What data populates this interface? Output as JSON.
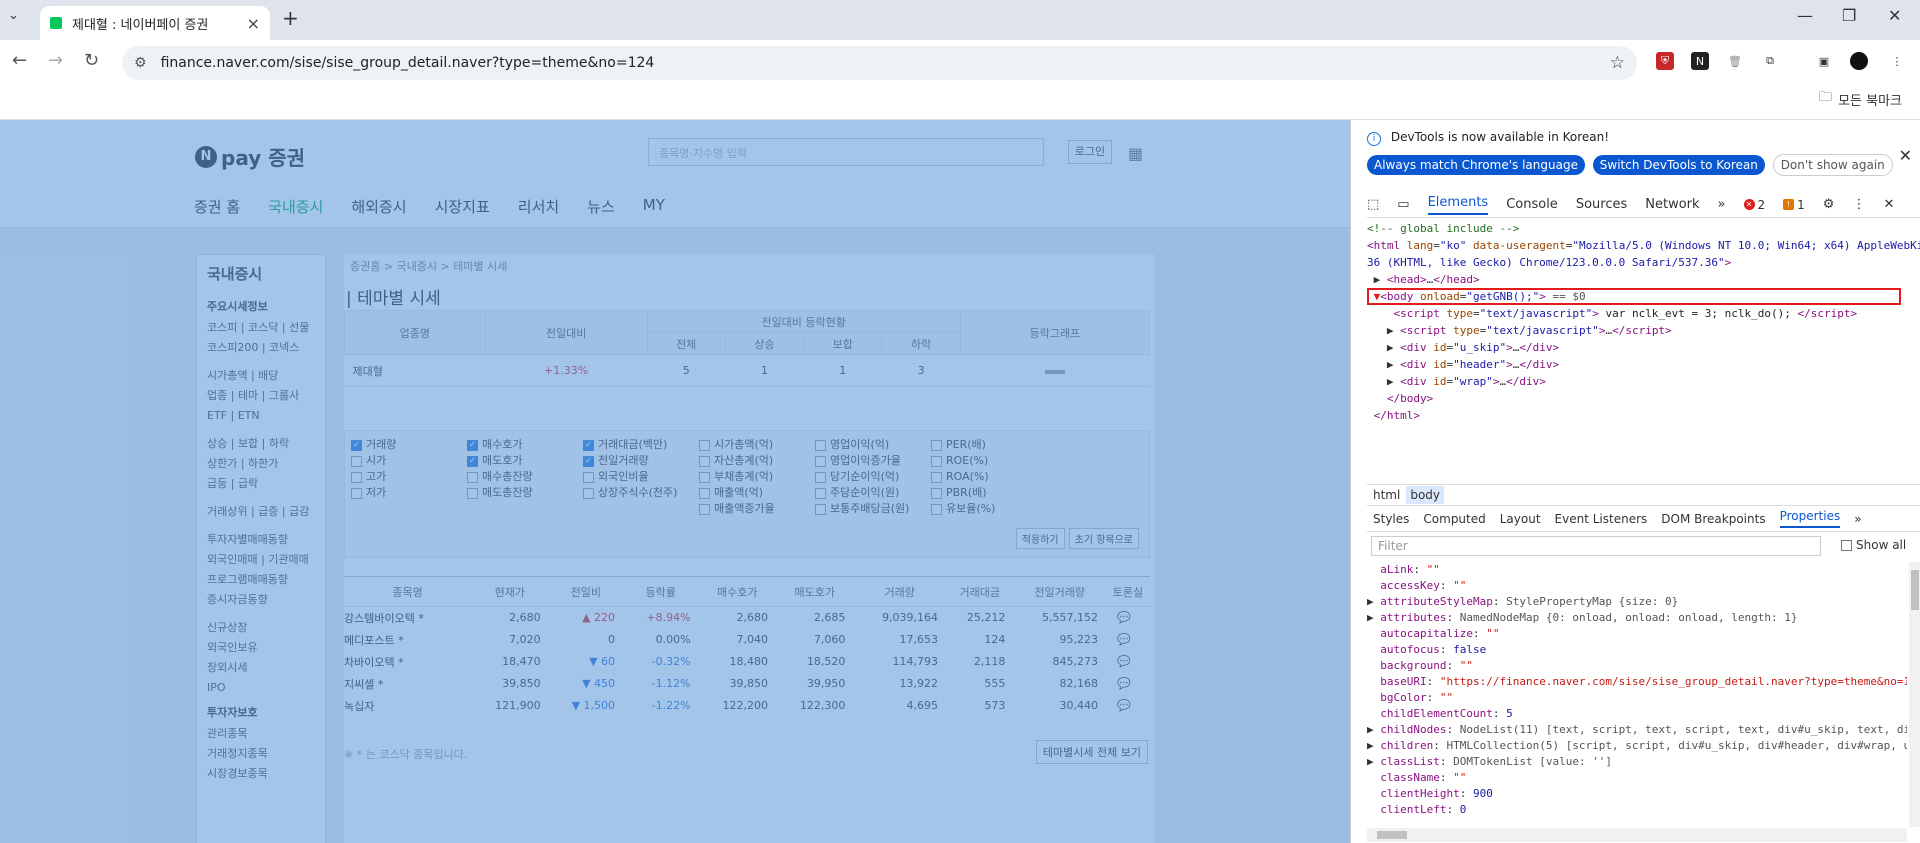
{
  "browser": {
    "tab_title": "제대혈 : 네이버페이 증권",
    "url": "finance.naver.com/sise/sise_group_detail.naver?type=theme&no=124",
    "bookmarks_label": "모든 북마크",
    "extension_badge": "2"
  },
  "page": {
    "logo_text": "pay 증권",
    "logo_n": "N",
    "search_placeholder": "종목명·지수명 입력",
    "login_label": "로그인",
    "gnb": [
      "증권 홈",
      "국내증시",
      "해외증시",
      "시장지표",
      "리서치",
      "뉴스",
      "MY"
    ],
    "lnb": {
      "title": "국내증시",
      "sections": [
        {
          "title": "주요시세정보",
          "items": [
            "코스피 | 코스닥 | 선물",
            "코스피200 | 코넥스",
            "",
            "시가총액 | 배당",
            "업종 | 테마 | 그룹사",
            "ETF | ETN",
            "",
            "상승 | 보합 | 하락",
            "상한가 | 하한가",
            "급등 | 급락",
            "",
            "거래상위 | 급증 | 급감",
            "",
            "투자자별매매동향",
            "외국인매매 | 기관매매",
            "프로그램매매동향",
            "증시자금동향",
            "",
            "신규상장",
            "외국인보유",
            "장외시세",
            "IPO"
          ]
        },
        {
          "title": "투자자보호",
          "items": [
            "관리종목",
            "거래정지종목",
            "시장경보종목"
          ]
        }
      ]
    },
    "breadcrumb": "증권홈 > 국내증시 > 테마별 시세",
    "title": "테마별 시세",
    "summary": {
      "headers": {
        "group": "업종명",
        "change": "전일대비",
        "status": "전일대비 등락현황",
        "graph": "등락그래프",
        "sub": [
          "전체",
          "상승",
          "보합",
          "하락"
        ]
      },
      "row": {
        "name": "제대혈",
        "change": "+1.33%",
        "total": "5",
        "up": "1",
        "flat": "1",
        "down": "3"
      }
    },
    "filters": [
      [
        {
          "l": "거래량",
          "c": true
        },
        {
          "l": "시가",
          "c": false
        },
        {
          "l": "고가",
          "c": false
        },
        {
          "l": "저가",
          "c": false
        }
      ],
      [
        {
          "l": "매수호가",
          "c": true
        },
        {
          "l": "매도호가",
          "c": true
        },
        {
          "l": "매수총잔량",
          "c": false
        },
        {
          "l": "매도총잔량",
          "c": false
        }
      ],
      [
        {
          "l": "거래대금(백만)",
          "c": true
        },
        {
          "l": "전일거래량",
          "c": true
        },
        {
          "l": "외국인비율",
          "c": false
        },
        {
          "l": "상장주식수(천주)",
          "c": false
        }
      ],
      [
        {
          "l": "시가총액(억)",
          "c": false
        },
        {
          "l": "자산총계(억)",
          "c": false
        },
        {
          "l": "부채총계(억)",
          "c": false
        },
        {
          "l": "매출액(억)",
          "c": false
        },
        {
          "l": "매출액증가율",
          "c": false
        }
      ],
      [
        {
          "l": "영업이익(억)",
          "c": false
        },
        {
          "l": "영업이익증가율",
          "c": false
        },
        {
          "l": "당기순이익(억)",
          "c": false
        },
        {
          "l": "주당순이익(원)",
          "c": false
        },
        {
          "l": "보통주배당금(원)",
          "c": false
        }
      ],
      [
        {
          "l": "PER(배)",
          "c": false
        },
        {
          "l": "ROE(%)",
          "c": false
        },
        {
          "l": "ROA(%)",
          "c": false
        },
        {
          "l": "PBR(배)",
          "c": false
        },
        {
          "l": "유보율(%)",
          "c": false
        }
      ]
    ],
    "filter_buttons": [
      "적용하기",
      "초기 항목으로"
    ],
    "stock_headers": [
      "종목명",
      "현재가",
      "전일비",
      "등락률",
      "매수호가",
      "매도호가",
      "거래량",
      "거래대금",
      "전일거래량",
      "토론실"
    ],
    "stocks": [
      {
        "name": "강스템바이오텍 *",
        "price": "2,680",
        "diff": "▲ 220",
        "dir": "up",
        "rate": "+8.94%",
        "bid": "2,680",
        "ask": "2,685",
        "vol": "9,039,164",
        "amt": "25,212",
        "pvol": "5,557,152"
      },
      {
        "name": "메디포스트 *",
        "price": "7,020",
        "diff": "0",
        "dir": "flat",
        "rate": "0.00%",
        "bid": "7,040",
        "ask": "7,060",
        "vol": "17,653",
        "amt": "124",
        "pvol": "95,223"
      },
      {
        "name": "차바이오텍 *",
        "price": "18,470",
        "diff": "▼ 60",
        "dir": "dn",
        "rate": "-0.32%",
        "bid": "18,480",
        "ask": "18,520",
        "vol": "114,793",
        "amt": "2,118",
        "pvol": "845,273"
      },
      {
        "name": "지씨셀 *",
        "price": "39,850",
        "diff": "▼ 450",
        "dir": "dn",
        "rate": "-1.12%",
        "bid": "39,850",
        "ask": "39,950",
        "vol": "13,922",
        "amt": "555",
        "pvol": "82,168"
      },
      {
        "name": "녹십자",
        "price": "121,900",
        "diff": "▼ 1,500",
        "dir": "dn",
        "rate": "-1.22%",
        "bid": "122,200",
        "ask": "122,300",
        "vol": "4,695",
        "amt": "573",
        "pvol": "30,440"
      }
    ],
    "note": "※ * 는 코스닥 종목입니다.",
    "all_button": "테마별시세 전체 보기"
  },
  "devtools": {
    "info": "DevTools is now available in Korean!",
    "buttons": [
      "Always match Chrome's language",
      "Switch DevTools to Korean",
      "Don't show again"
    ],
    "tabs": [
      "Elements",
      "Console",
      "Sources",
      "Network",
      "»"
    ],
    "errors": "2",
    "warnings": "1",
    "breadcrumb": [
      "html",
      "body"
    ],
    "panel_tabs": [
      "Styles",
      "Computed",
      "Layout",
      "Event Listeners",
      "DOM Breakpoints",
      "Properties",
      "»"
    ],
    "filter_placeholder": "Filter",
    "show_all": "Show all"
  },
  "colors": {
    "accent": "#0b57d0",
    "naver_green": "#03a45e",
    "overlay": "#5596d7",
    "highlight_border": "#e31b1b"
  }
}
